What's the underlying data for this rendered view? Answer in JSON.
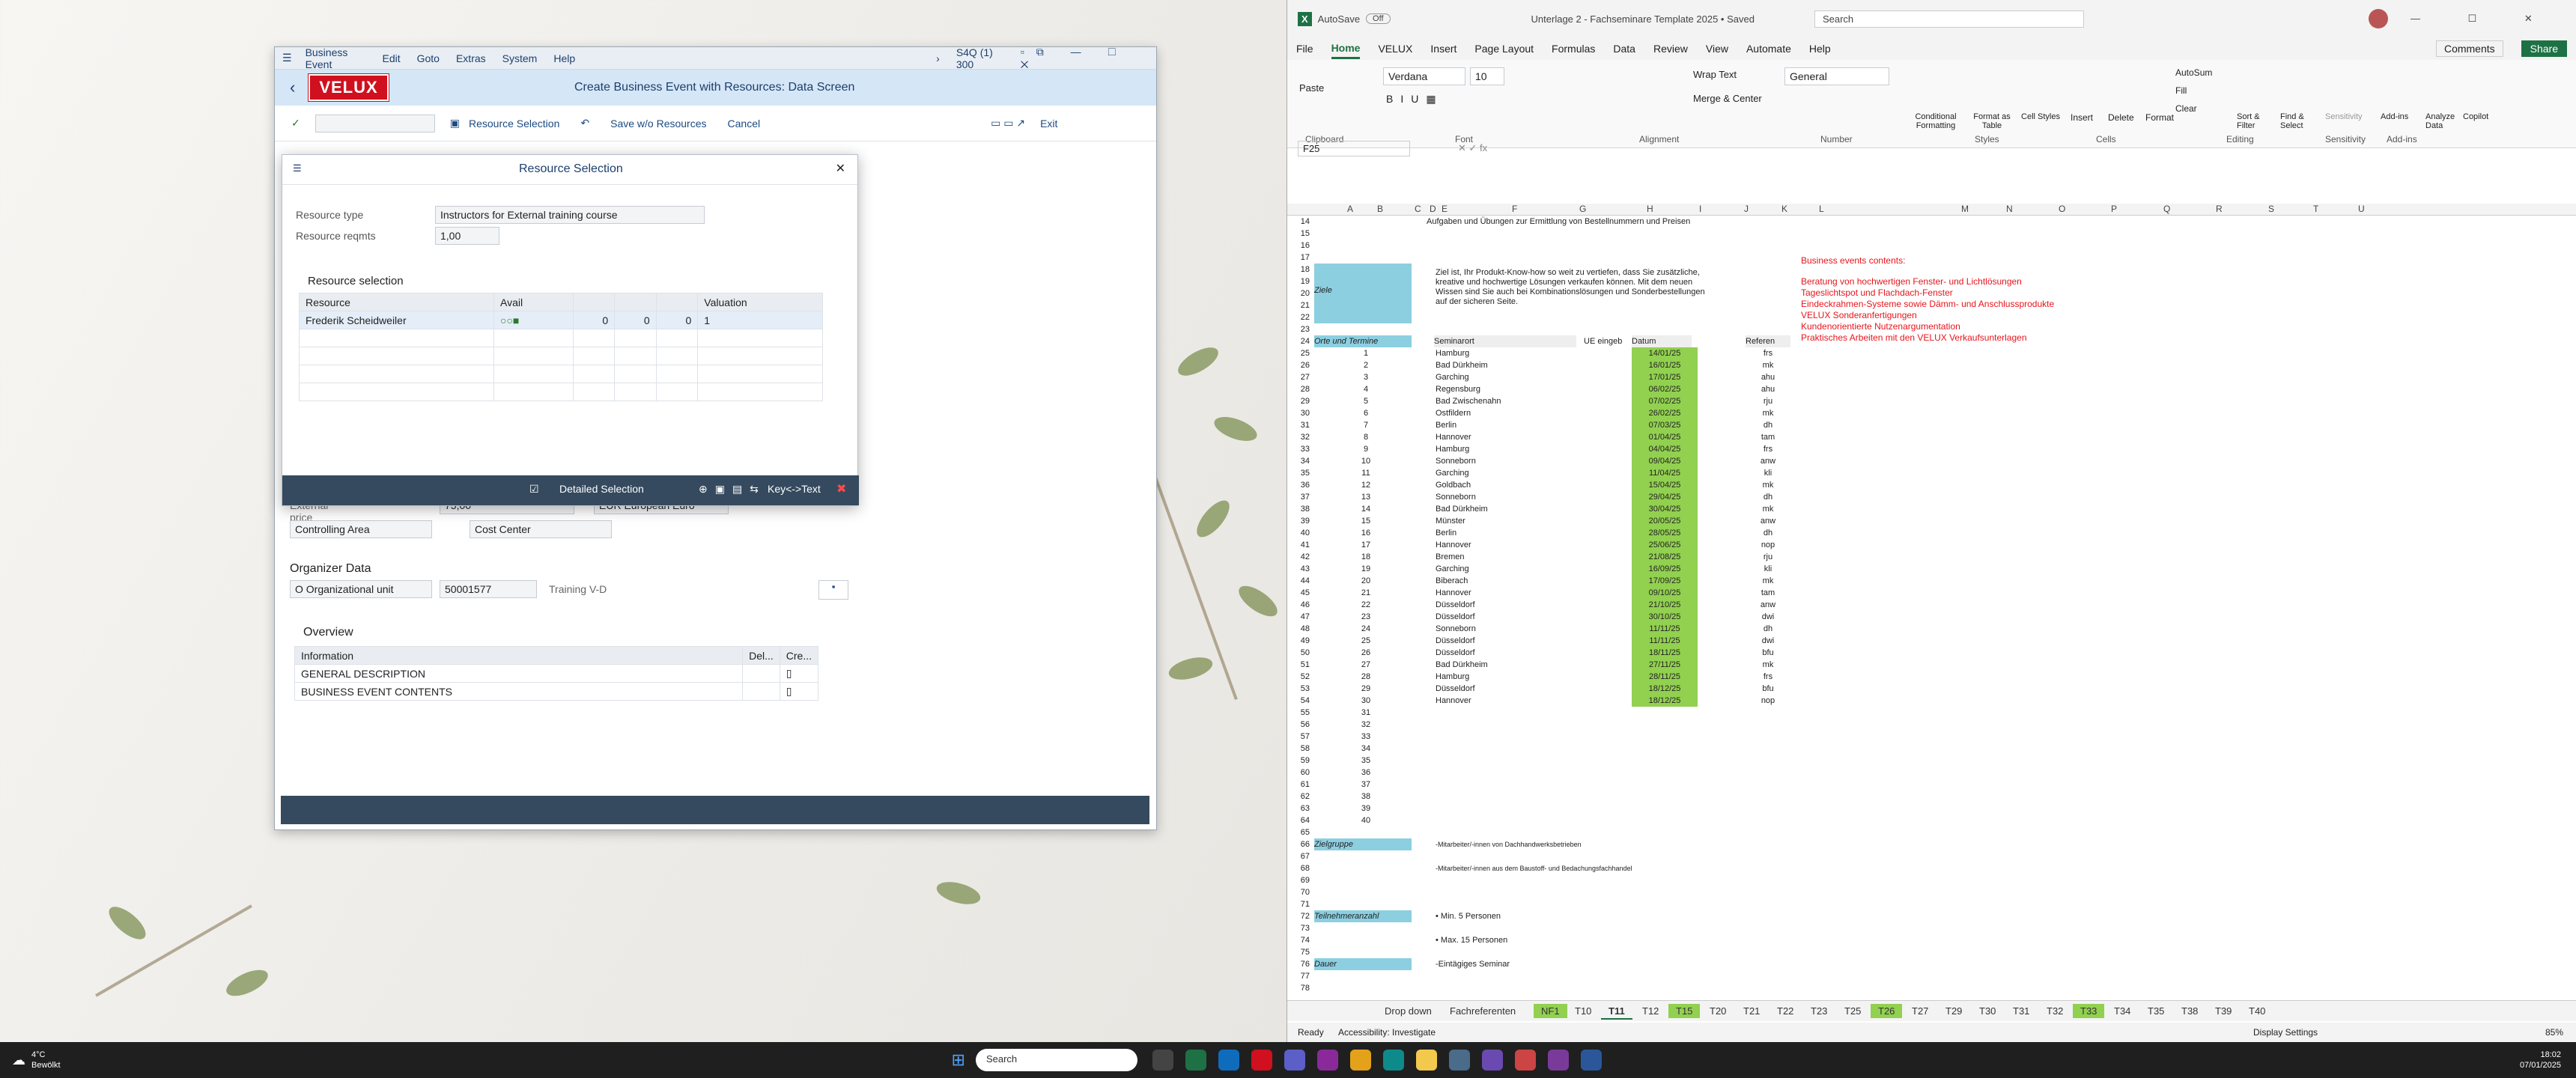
{
  "sap": {
    "menu": [
      "Business Event",
      "Edit",
      "Goto",
      "Extras",
      "System",
      "Help"
    ],
    "system": "S4Q (1) 300",
    "logo": "VELUX",
    "title": "Create Business Event with Resources: Data Screen",
    "toolbar": {
      "resource_selection": "Resource Selection",
      "save_wo": "Save w/o Resources",
      "cancel": "Cancel",
      "exit": "Exit"
    },
    "external_price_label": "External price",
    "external_price": "75,00",
    "currency": "EUR European Euro",
    "controlling_area_label": "Controlling Area",
    "cost_center_label": "Cost Center",
    "organizer_title": "Organizer Data",
    "org_unit": "O Organizational unit",
    "org_id": "50001577",
    "org_name": "Training V-D",
    "overview_title": "Overview",
    "overview_cols": [
      "Information",
      "Del...",
      "Cre..."
    ],
    "overview_rows": [
      "GENERAL DESCRIPTION",
      "BUSINESS EVENT CONTENTS"
    ]
  },
  "dialog": {
    "title": "Resource Selection",
    "resource_type_label": "Resource type",
    "resource_type": "Instructors for External training course",
    "reqmts_label": "Resource reqmts",
    "reqmts": "1,00",
    "section": "Resource selection",
    "cols": [
      "Resource",
      "Avail",
      "",
      "",
      "",
      "Valuation"
    ],
    "row": {
      "name": "Frederik Scheidweiler",
      "a": "0",
      "b": "0",
      "c": "0",
      "v": "1"
    },
    "footer": {
      "detailed": "Detailed Selection",
      "keytext": "Key<->Text"
    }
  },
  "excel": {
    "autosave": "AutoSave",
    "autosave_state": "Off",
    "file_title": "Unterlage 2 - Fachseminare Template 2025 • Saved",
    "search": "Search",
    "tabs": [
      "File",
      "Home",
      "VELUX",
      "Insert",
      "Page Layout",
      "Formulas",
      "Data",
      "Review",
      "View",
      "Automate",
      "Help"
    ],
    "comments": "Comments",
    "share": "Share",
    "font": "Verdana",
    "size": "10",
    "number_format": "General",
    "groups": [
      "Clipboard",
      "Font",
      "Alignment",
      "Number",
      "Styles",
      "Cells",
      "Editing",
      "Sensitivity",
      "Add-ins"
    ],
    "ribbon_buttons": [
      "Paste",
      "Wrap Text",
      "Merge & Center",
      "Conditional Formatting",
      "Format as Table",
      "Cell Styles",
      "Insert",
      "Delete",
      "Format",
      "AutoSum",
      "Fill",
      "Clear",
      "Sort & Filter",
      "Find & Select",
      "Sensitivity",
      "Add-ins",
      "Analyze Data",
      "Copilot"
    ],
    "namebox": "F25",
    "columns": [
      "A",
      "B",
      "C",
      "D",
      "E",
      "F",
      "G",
      "H",
      "I",
      "J",
      "K",
      "L",
      "M",
      "N",
      "O",
      "P",
      "Q",
      "R",
      "S",
      "T",
      "U"
    ],
    "row14": "Aufgaben und Übungen zur Ermittlung von Bestellnummern und Preisen",
    "ziel_text": [
      "Ziel ist, Ihr Produkt-Know-how so weit zu vertiefen, dass Sie zusätzliche,",
      "kreative und hochwertige Lösungen verkaufen können. Mit dem neuen",
      "Wissen sind Sie auch bei Kombinationslösungen und Sonderbestellungen",
      "auf der sicheren Seite."
    ],
    "ziele": "Ziele",
    "contents_title": "Business events contents:",
    "contents": [
      "Beratung von hochwertigen Fenster- und Lichtlösungen",
      "Tageslichtspot und Flachdach-Fenster",
      "Eindeckrahmen-Systeme sowie Dämm- und Anschlussprodukte",
      "VELUX Sonderanfertigungen",
      "Kundenorientierte Nutzenargumentation",
      "Praktisches Arbeiten mit den VELUX Verkaufsunterlagen"
    ],
    "hdr": {
      "orte": "Orte und Termine",
      "seminarort": "Seminarort",
      "ue": "UE eingeb",
      "datum": "Datum",
      "ref": "Referen"
    },
    "events": [
      [
        "1",
        "Hamburg",
        "14/01/25",
        "frs"
      ],
      [
        "2",
        "Bad Dürkheim",
        "16/01/25",
        "mk"
      ],
      [
        "3",
        "Garching",
        "17/01/25",
        "ahu"
      ],
      [
        "4",
        "Regensburg",
        "06/02/25",
        "ahu"
      ],
      [
        "5",
        "Bad Zwischenahn",
        "07/02/25",
        "rju"
      ],
      [
        "6",
        "Ostfildern",
        "26/02/25",
        "mk"
      ],
      [
        "7",
        "Berlin",
        "07/03/25",
        "dh"
      ],
      [
        "8",
        "Hannover",
        "01/04/25",
        "tam"
      ],
      [
        "9",
        "Hamburg",
        "04/04/25",
        "frs"
      ],
      [
        "10",
        "Sonneborn",
        "09/04/25",
        "anw"
      ],
      [
        "11",
        "Garching",
        "11/04/25",
        "kli"
      ],
      [
        "12",
        "Goldbach",
        "15/04/25",
        "mk"
      ],
      [
        "13",
        "Sonneborn",
        "29/04/25",
        "dh"
      ],
      [
        "14",
        "Bad Dürkheim",
        "30/04/25",
        "mk"
      ],
      [
        "15",
        "Münster",
        "20/05/25",
        "anw"
      ],
      [
        "16",
        "Berlin",
        "28/05/25",
        "dh"
      ],
      [
        "17",
        "Hannover",
        "25/06/25",
        "nop"
      ],
      [
        "18",
        "Bremen",
        "21/08/25",
        "rju"
      ],
      [
        "19",
        "Garching",
        "16/09/25",
        "kli"
      ],
      [
        "20",
        "Biberach",
        "17/09/25",
        "mk"
      ],
      [
        "21",
        "Hannover",
        "09/10/25",
        "tam"
      ],
      [
        "22",
        "Düsseldorf",
        "21/10/25",
        "anw"
      ],
      [
        "23",
        "Düsseldorf",
        "30/10/25",
        "dwi"
      ],
      [
        "24",
        "Sonneborn",
        "11/11/25",
        "dh"
      ],
      [
        "25",
        "Düsseldorf",
        "11/11/25",
        "dwi"
      ],
      [
        "26",
        "Düsseldorf",
        "18/11/25",
        "bfu"
      ],
      [
        "27",
        "Bad Dürkheim",
        "27/11/25",
        "mk"
      ],
      [
        "28",
        "Hamburg",
        "28/11/25",
        "frs"
      ],
      [
        "29",
        "Düsseldorf",
        "18/12/25",
        "bfu"
      ],
      [
        "30",
        "Hannover",
        "18/12/25",
        "nop"
      ]
    ],
    "empty_nums": [
      "31",
      "32",
      "33",
      "34",
      "35",
      "36",
      "37",
      "38",
      "39",
      "40"
    ],
    "zielgruppe": "Zielgruppe",
    "zg1": "-Mitarbeiter/-innen von Dachhandwerksbetrieben",
    "zg2": "-Mitarbeiter/-innen aus dem Baustoff- und Bedachungsfachhandel",
    "teilnehmer": "Teilnehmeranzahl",
    "tn1": "• Min. 5 Personen",
    "tn2": "• Max. 15 Personen",
    "dauer": "Dauer",
    "dauer_v": "-Eintägiges Seminar",
    "sheets": [
      "Drop down",
      "Fachreferenten",
      "NF1",
      "T10",
      "T11",
      "T12",
      "T15",
      "T20",
      "T21",
      "T22",
      "T23",
      "T25",
      "T26",
      "T27",
      "T29",
      "T30",
      "T31",
      "T32",
      "T33",
      "T34",
      "T35",
      "T38",
      "T39",
      "T40"
    ],
    "status_ready": "Ready",
    "accessibility": "Accessibility: Investigate",
    "display": "Display Settings",
    "zoom": "85%"
  },
  "taskbar": {
    "temp": "4°C",
    "weather": "Bewölkt",
    "search": "Search",
    "time": "18:02",
    "date": "07/01/2025"
  }
}
